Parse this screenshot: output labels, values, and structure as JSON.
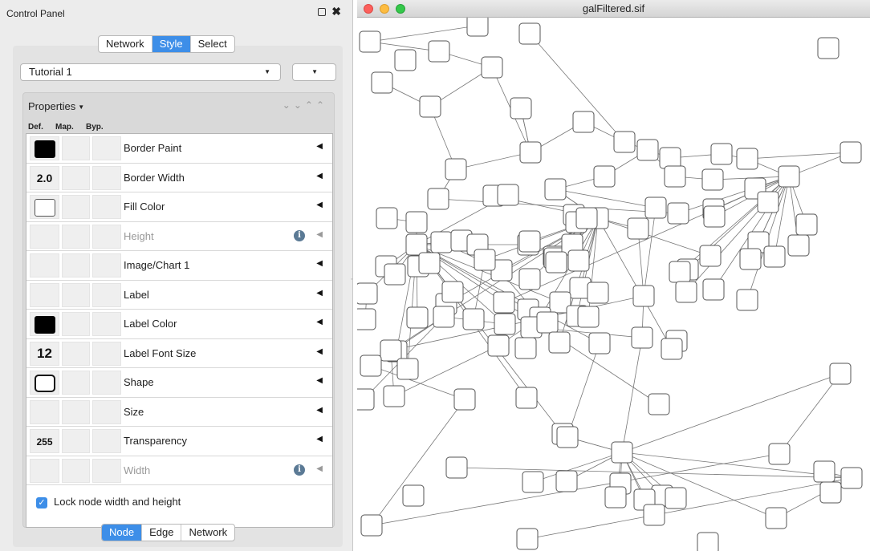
{
  "control_panel": {
    "title": "Control Panel",
    "tabs": [
      {
        "label": "Network",
        "active": false
      },
      {
        "label": "Style",
        "active": true
      },
      {
        "label": "Select",
        "active": false
      }
    ],
    "style_dropdown": {
      "value": "Tutorial 1"
    },
    "properties": {
      "header": "Properties",
      "columns": {
        "def": "Def.",
        "map": "Map.",
        "byp": "Byp."
      },
      "rows": [
        {
          "label": "Border Paint",
          "def_kind": "swatch",
          "def_value": "",
          "disabled": false,
          "info": false
        },
        {
          "label": "Border Width",
          "def_kind": "text",
          "def_value": "2.0",
          "disabled": false,
          "info": false
        },
        {
          "label": "Fill Color",
          "def_kind": "fill",
          "def_value": "",
          "disabled": false,
          "info": false
        },
        {
          "label": "Height",
          "def_kind": "none",
          "def_value": "",
          "disabled": true,
          "info": true
        },
        {
          "label": "Image/Chart 1",
          "def_kind": "none",
          "def_value": "",
          "disabled": false,
          "info": false
        },
        {
          "label": "Label",
          "def_kind": "none",
          "def_value": "",
          "disabled": false,
          "info": false
        },
        {
          "label": "Label Color",
          "def_kind": "swatch",
          "def_value": "",
          "disabled": false,
          "info": false
        },
        {
          "label": "Label Font Size",
          "def_kind": "text",
          "def_value": "12",
          "disabled": false,
          "info": false
        },
        {
          "label": "Shape",
          "def_kind": "shape",
          "def_value": "",
          "disabled": false,
          "info": false
        },
        {
          "label": "Size",
          "def_kind": "none",
          "def_value": "",
          "disabled": false,
          "info": false
        },
        {
          "label": "Transparency",
          "def_kind": "text",
          "def_value": "255",
          "disabled": false,
          "info": false
        },
        {
          "label": "Width",
          "def_kind": "none",
          "def_value": "",
          "disabled": true,
          "info": true
        }
      ],
      "lock_label": "Lock node width and height",
      "lock_checked": true
    },
    "bottom_tabs": [
      {
        "label": "Node",
        "active": true
      },
      {
        "label": "Edge",
        "active": false
      },
      {
        "label": "Network",
        "active": false
      }
    ]
  },
  "network_window": {
    "title": "galFiltered.sif"
  },
  "colors": {
    "accent": "#3d8ee8",
    "swatch_black": "#000000",
    "node_border": "#555555",
    "edge": "#777777"
  }
}
